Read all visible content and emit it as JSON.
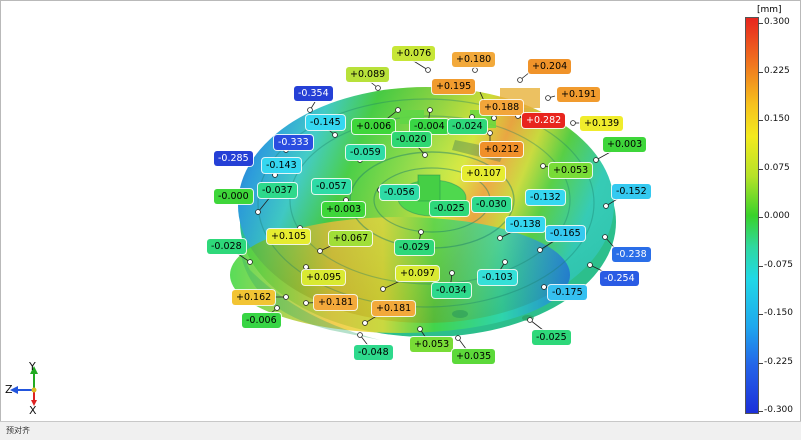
{
  "status_text": "预对齐",
  "colorbar": {
    "unit": "[mm]",
    "ticks": [
      "0.300",
      "0.225",
      "0.150",
      "0.075",
      "0.000",
      "-0.075",
      "-0.150",
      "-0.225",
      "-0.300"
    ]
  },
  "axis": {
    "y": "Y",
    "z": "Z",
    "x": "X"
  },
  "labels": [
    {
      "text": "+0.076",
      "color": "#c7e637"
    },
    {
      "text": "+0.180",
      "color": "#f2a93b"
    },
    {
      "text": "+0.204",
      "color": "#f0932a"
    },
    {
      "text": "+0.089",
      "color": "#b8e13a"
    },
    {
      "text": "+0.195",
      "color": "#f19b2e"
    },
    {
      "text": "+0.191",
      "color": "#f19b2e"
    },
    {
      "text": "-0.354",
      "color": "#2540d6"
    },
    {
      "text": "+0.188",
      "color": "#f2a53a"
    },
    {
      "text": "+0.282",
      "color": "#e8251e"
    },
    {
      "text": "+0.139",
      "color": "#f0ec2c"
    },
    {
      "text": "-0.145",
      "color": "#35d7f0"
    },
    {
      "text": "+0.006",
      "color": "#3ed63a"
    },
    {
      "text": "-0.004",
      "color": "#38d544"
    },
    {
      "text": "-0.024",
      "color": "#2ed87a"
    },
    {
      "text": "-0.020",
      "color": "#2fd772"
    },
    {
      "text": "+0.003",
      "color": "#3ed63a"
    },
    {
      "text": "-0.333",
      "color": "#2a4de0"
    },
    {
      "text": "+0.212",
      "color": "#f0902a"
    },
    {
      "text": "-0.059",
      "color": "#2edba6"
    },
    {
      "text": "-0.285",
      "color": "#2540d6"
    },
    {
      "text": "-0.143",
      "color": "#35d7f0"
    },
    {
      "text": "+0.107",
      "color": "#e6ec30"
    },
    {
      "text": "+0.053",
      "color": "#78dc36"
    },
    {
      "text": "-0.000",
      "color": "#3ed63a"
    },
    {
      "text": "-0.037",
      "color": "#2ed98c"
    },
    {
      "text": "-0.057",
      "color": "#2edba6"
    },
    {
      "text": "-0.056",
      "color": "#2edba6"
    },
    {
      "text": "-0.030",
      "color": "#2ed98c"
    },
    {
      "text": "-0.132",
      "color": "#35d7f0"
    },
    {
      "text": "-0.152",
      "color": "#35c9f0"
    },
    {
      "text": "+0.003",
      "color": "#3ed63a"
    },
    {
      "text": "-0.025",
      "color": "#2ed87a"
    },
    {
      "text": "-0.138",
      "color": "#35d7f0"
    },
    {
      "text": "+0.105",
      "color": "#e6ec30"
    },
    {
      "text": "+0.067",
      "color": "#a0df38"
    },
    {
      "text": "-0.165",
      "color": "#35c9f0"
    },
    {
      "text": "-0.028",
      "color": "#2ed87a"
    },
    {
      "text": "-0.029",
      "color": "#2ed87a"
    },
    {
      "text": "-0.238",
      "color": "#2a6ee8"
    },
    {
      "text": "+0.095",
      "color": "#d9e932"
    },
    {
      "text": "+0.097",
      "color": "#d9e932"
    },
    {
      "text": "-0.103",
      "color": "#35e0d8"
    },
    {
      "text": "-0.254",
      "color": "#2a5be4"
    },
    {
      "text": "-0.034",
      "color": "#2ed98c"
    },
    {
      "text": "-0.175",
      "color": "#35c0f0"
    },
    {
      "text": "+0.162",
      "color": "#f2c434"
    },
    {
      "text": "+0.181",
      "color": "#f2a93b"
    },
    {
      "text": "+0.181",
      "color": "#f2a93b"
    },
    {
      "text": "-0.006",
      "color": "#38d544"
    },
    {
      "text": "-0.025",
      "color": "#2ed87a"
    },
    {
      "text": "+0.053",
      "color": "#78dc36"
    },
    {
      "text": "-0.048",
      "color": "#2ed98c"
    },
    {
      "text": "+0.035",
      "color": "#5cd93a"
    }
  ]
}
